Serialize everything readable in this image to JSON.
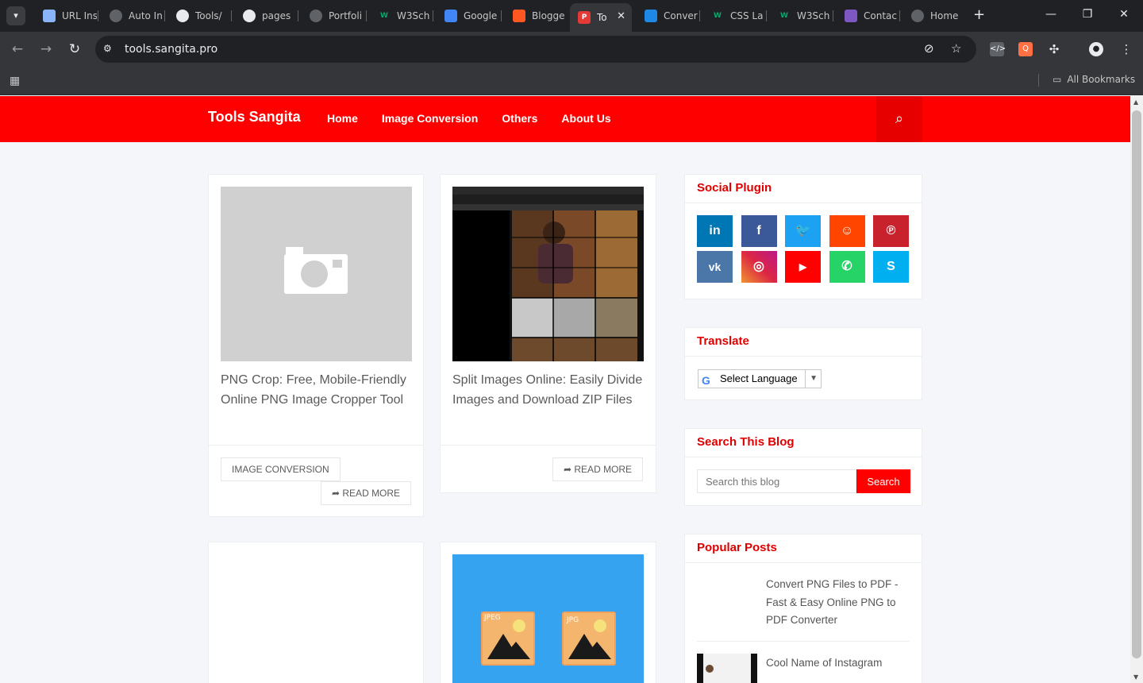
{
  "browser": {
    "tabs": [
      {
        "label": "URL Ins",
        "favicon_color": "#8ab4f8"
      },
      {
        "label": "Auto In",
        "favicon_color": "#9aa0a6"
      },
      {
        "label": "Tools/",
        "favicon_color": "#e8eaed"
      },
      {
        "label": "pages",
        "favicon_color": "#e8eaed"
      },
      {
        "label": "Portfoli",
        "favicon_color": "#9aa0a6"
      },
      {
        "label": "W3Sch",
        "favicon_color": "#04aa6d"
      },
      {
        "label": "Google",
        "favicon_color": "#4285f4"
      },
      {
        "label": "Blogge",
        "favicon_color": "#ff5722"
      },
      {
        "label": "To",
        "favicon_color": "#e53935",
        "active": true
      },
      {
        "label": "Conver",
        "favicon_color": "#1e88e5"
      },
      {
        "label": "CSS La",
        "favicon_color": "#04aa6d"
      },
      {
        "label": "W3Sch",
        "favicon_color": "#04aa6d"
      },
      {
        "label": "Contac",
        "favicon_color": "#7e57c2"
      },
      {
        "label": "Home",
        "favicon_color": "#9aa0a6"
      }
    ],
    "url": "tools.sangita.pro",
    "all_bookmarks": "All Bookmarks"
  },
  "site": {
    "brand": "Tools Sangita",
    "nav": [
      "Home",
      "Image Conversion",
      "Others",
      "About Us"
    ],
    "accent": "#ff0000"
  },
  "posts": [
    {
      "title": "PNG Crop: Free, Mobile-Friendly Online PNG Image Cropper Tool",
      "label": "IMAGE CONVERSION",
      "read_more": "READ MORE"
    },
    {
      "title": "Split Images Online: Easily Divide Images and Download ZIP Files",
      "read_more": "READ MORE"
    },
    {
      "title": ""
    },
    {
      "title": "",
      "badges": [
        "JPEG",
        "JPG"
      ]
    }
  ],
  "sidebar": {
    "social": {
      "title": "Social Plugin",
      "icons": [
        {
          "name": "linkedin",
          "glyph": "in",
          "color": "#0077b5"
        },
        {
          "name": "facebook",
          "glyph": "f",
          "color": "#3b5998"
        },
        {
          "name": "twitter",
          "glyph": "t",
          "color": "#1da1f2"
        },
        {
          "name": "reddit",
          "glyph": "r",
          "color": "#ff4500"
        },
        {
          "name": "pinterest",
          "glyph": "P",
          "color": "#c8232c"
        },
        {
          "name": "vk",
          "glyph": "vk",
          "color": "#4a76a8"
        },
        {
          "name": "instagram",
          "glyph": "◎",
          "color": "#d6249f"
        },
        {
          "name": "youtube",
          "glyph": "▶",
          "color": "#ff0000"
        },
        {
          "name": "whatsapp",
          "glyph": "✆",
          "color": "#25d366"
        },
        {
          "name": "skype",
          "glyph": "S",
          "color": "#00aff0"
        }
      ]
    },
    "translate": {
      "title": "Translate",
      "select_label": "Select Language"
    },
    "search": {
      "title": "Search This Blog",
      "placeholder": "Search this blog",
      "button": "Search"
    },
    "popular": {
      "title": "Popular Posts",
      "items": [
        {
          "title": "Convert PNG Files to PDF - Fast & Easy Online PNG to PDF Converter"
        },
        {
          "title": "Cool Name of Instagram"
        }
      ]
    }
  }
}
